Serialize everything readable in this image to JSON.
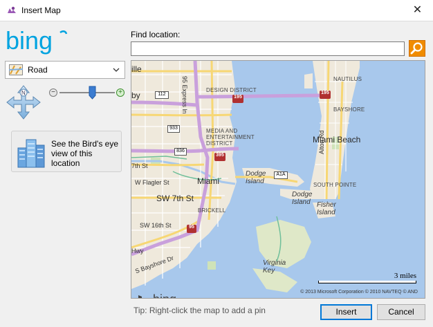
{
  "window": {
    "title": "Insert Map",
    "close_symbol": "✕",
    "title_icon": "map-pin-icon"
  },
  "sidebar": {
    "logo_text": "bing",
    "map_style": {
      "selected": "Road"
    },
    "birds_eye_text": "See the Bird's eye view of this location"
  },
  "search": {
    "label": "Find location:",
    "value": "",
    "button_icon": "search-icon"
  },
  "map": {
    "labels": {
      "city_miami": "Miami",
      "city_miami_beach": "Miami Beach",
      "expressway": "95 Express ln",
      "design_district": "DESIGN DISTRICT",
      "media_district": "MEDIA AND ENTERTAINMENT DISTRICT",
      "nautilus": "NAUTILUS",
      "bayshore": "BAYSHORE",
      "south_pointe": "SOUTH POINTE",
      "brickell": "BRICKELL",
      "dodge_island_1": "Dodge Island",
      "dodge_island_2": "Dodge Island",
      "fisher_island": "Fisher Island",
      "virginia_key": "Virginia Key",
      "alton_rd": "Alton Rd",
      "ille": "ille",
      "by": "by",
      "seventh_st": "7th St",
      "w_flagler": "W Flagler St",
      "sw_7th": "SW 7th St",
      "sw_16th": "SW 16th St",
      "s_bayshore": "S Bayshore Dr",
      "hwy": "Hwy"
    },
    "shields": {
      "s112": "112",
      "s195a": "195",
      "s195b": "195",
      "s933": "933",
      "s836": "836",
      "s395": "395",
      "sA1A": "A1A",
      "s95": "95"
    },
    "scale_label": "3 miles",
    "copyright": "© 2013 Microsoft Corporation  © 2010 NAVTEQ  © AND",
    "logo_text": "bing"
  },
  "footer": {
    "tip": "Tip: Right-click the map to add a pin",
    "insert_label": "Insert",
    "cancel_label": "Cancel"
  },
  "colors": {
    "bing_blue": "#00a3e0",
    "water": "#a8c8ec",
    "land": "#efe9dc",
    "highway": "#c9a0dc",
    "search_orange": "#f08c00"
  }
}
